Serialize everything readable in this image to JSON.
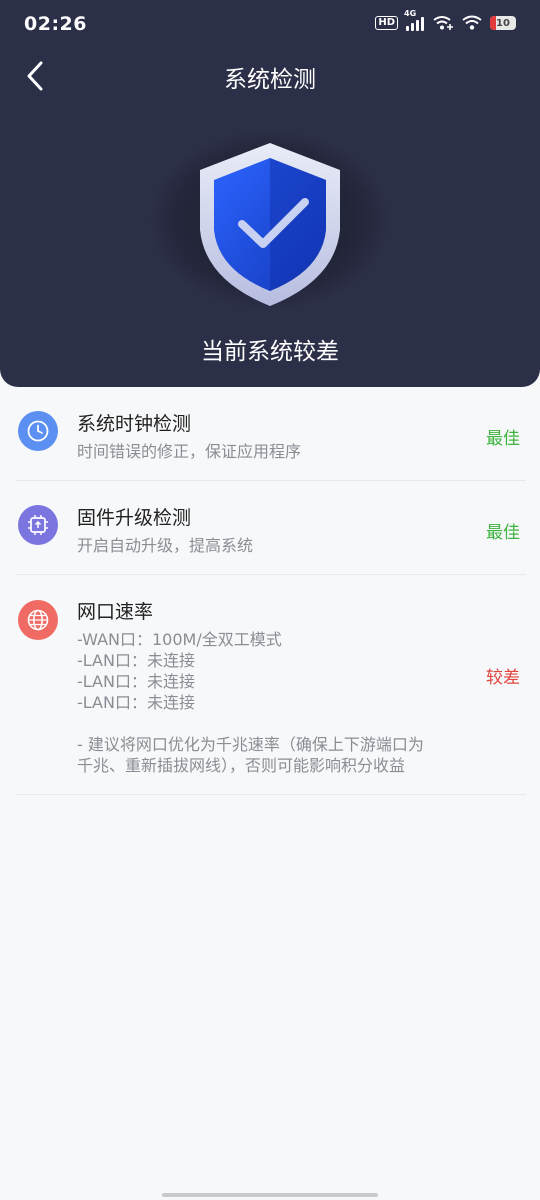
{
  "status_bar": {
    "time": "02:26",
    "hd": "HD",
    "network": "4G",
    "battery": "10"
  },
  "header": {
    "title": "系统检测",
    "status": "当前系统较差"
  },
  "items": [
    {
      "icon": "clock-icon",
      "name": "系统时钟检测",
      "desc": [
        "时间错误的修正，保证应用程序"
      ],
      "result": "最佳",
      "result_color": "#3fb33f"
    },
    {
      "icon": "chip-icon",
      "name": "固件升级检测",
      "desc": [
        "开启自动升级，提高系统"
      ],
      "result": "最佳",
      "result_color": "#3fb33f"
    },
    {
      "icon": "globe-icon",
      "name": "网口速率",
      "desc": [
        "-WAN口：100M/全双工模式",
        "-LAN口：未连接",
        "-LAN口：未连接",
        "-LAN口：未连接"
      ],
      "note": [
        "- 建议将网口优化为千兆速率（确保上下游端口为",
        "千兆、重新插拔网线），否则可能影响积分收益"
      ],
      "result": "较差",
      "result_color": "#e0443c"
    }
  ],
  "colors": {
    "header_bg": "#2c2f48",
    "good": "#3fb33f",
    "bad": "#e0443c",
    "clock_icon": "#5b8ff2",
    "chip_icon": "#7b75e0",
    "globe_icon": "#ef6b64"
  }
}
